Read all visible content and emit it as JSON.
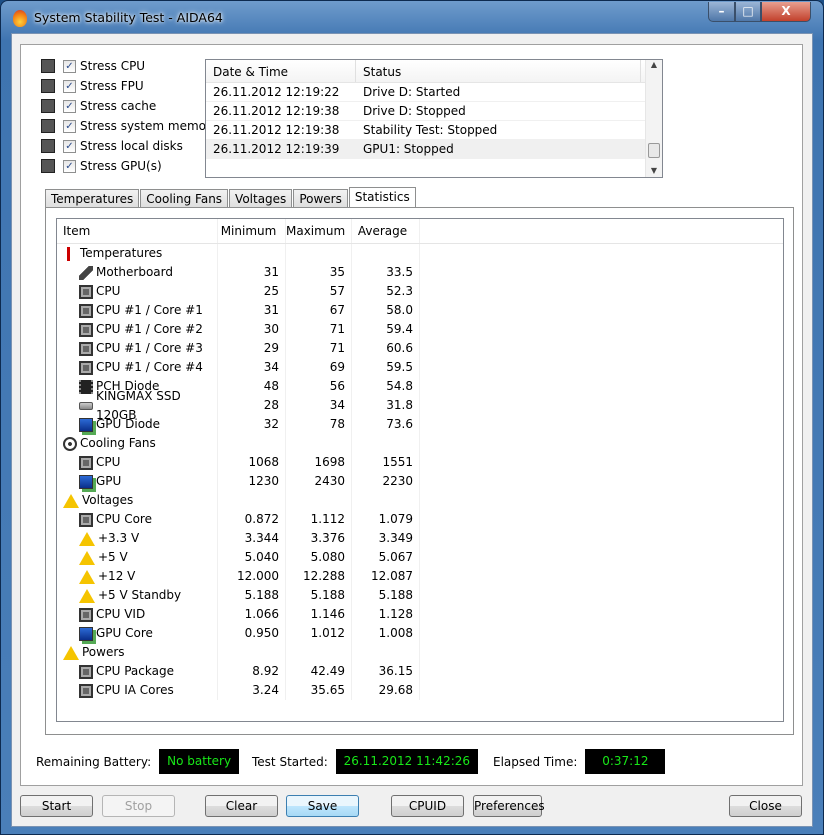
{
  "window": {
    "title": "System Stability Test - AIDA64",
    "minimize": "–",
    "maximize": "□",
    "close": "X"
  },
  "stress": [
    {
      "label": "Stress CPU",
      "checked": true,
      "icon": "cpu-icon"
    },
    {
      "label": "Stress FPU",
      "checked": true,
      "icon": "fpu-icon"
    },
    {
      "label": "Stress cache",
      "checked": true,
      "icon": "cache-icon"
    },
    {
      "label": "Stress system memory",
      "checked": true,
      "icon": "memory-icon"
    },
    {
      "label": "Stress local disks",
      "checked": true,
      "icon": "disk-icon"
    },
    {
      "label": "Stress GPU(s)",
      "checked": true,
      "icon": "gpu-icon"
    }
  ],
  "log": {
    "headers": [
      "Date & Time",
      "Status"
    ],
    "rows": [
      [
        "26.11.2012 12:19:22",
        "Drive D: Started"
      ],
      [
        "26.11.2012 12:19:38",
        "Drive D: Stopped"
      ],
      [
        "26.11.2012 12:19:38",
        "Stability Test: Stopped"
      ],
      [
        "26.11.2012 12:19:39",
        "GPU1: Stopped"
      ]
    ]
  },
  "tabs": [
    "Temperatures",
    "Cooling Fans",
    "Voltages",
    "Powers",
    "Statistics"
  ],
  "active_tab": "Statistics",
  "stats": {
    "headers": [
      "Item",
      "Minimum",
      "Maximum",
      "Average"
    ],
    "rows": [
      {
        "item": "Temperatures",
        "icon": "therm",
        "group": true
      },
      {
        "item": "Motherboard",
        "icon": "mb",
        "min": "31",
        "max": "35",
        "avg": "33.5"
      },
      {
        "item": "CPU",
        "icon": "chip",
        "min": "25",
        "max": "57",
        "avg": "52.3"
      },
      {
        "item": "CPU #1 / Core #1",
        "icon": "chip",
        "min": "31",
        "max": "67",
        "avg": "58.0"
      },
      {
        "item": "CPU #1 / Core #2",
        "icon": "chip",
        "min": "30",
        "max": "71",
        "avg": "59.4"
      },
      {
        "item": "CPU #1 / Core #3",
        "icon": "chip",
        "min": "29",
        "max": "71",
        "avg": "60.6"
      },
      {
        "item": "CPU #1 / Core #4",
        "icon": "chip",
        "min": "34",
        "max": "69",
        "avg": "59.5"
      },
      {
        "item": "PCH Diode",
        "icon": "pch",
        "min": "48",
        "max": "56",
        "avg": "54.8"
      },
      {
        "item": "KINGMAX SSD 120GB",
        "icon": "ssd",
        "min": "28",
        "max": "34",
        "avg": "31.8"
      },
      {
        "item": "GPU Diode",
        "icon": "gpu",
        "min": "32",
        "max": "78",
        "avg": "73.6"
      },
      {
        "item": "Cooling Fans",
        "icon": "fan",
        "group": true
      },
      {
        "item": "CPU",
        "icon": "chip",
        "min": "1068",
        "max": "1698",
        "avg": "1551"
      },
      {
        "item": "GPU",
        "icon": "gpu",
        "min": "1230",
        "max": "2430",
        "avg": "2230"
      },
      {
        "item": "Voltages",
        "icon": "warn",
        "group": true
      },
      {
        "item": "CPU Core",
        "icon": "chip",
        "min": "0.872",
        "max": "1.112",
        "avg": "1.079"
      },
      {
        "item": "+3.3 V",
        "icon": "warn",
        "min": "3.344",
        "max": "3.376",
        "avg": "3.349"
      },
      {
        "item": "+5 V",
        "icon": "warn",
        "min": "5.040",
        "max": "5.080",
        "avg": "5.067"
      },
      {
        "item": "+12 V",
        "icon": "warn",
        "min": "12.000",
        "max": "12.288",
        "avg": "12.087"
      },
      {
        "item": "+5 V Standby",
        "icon": "warn",
        "min": "5.188",
        "max": "5.188",
        "avg": "5.188"
      },
      {
        "item": "CPU VID",
        "icon": "chip",
        "min": "1.066",
        "max": "1.146",
        "avg": "1.128"
      },
      {
        "item": "GPU Core",
        "icon": "gpu",
        "min": "0.950",
        "max": "1.012",
        "avg": "1.008"
      },
      {
        "item": "Powers",
        "icon": "warn",
        "group": true
      },
      {
        "item": "CPU Package",
        "icon": "chip",
        "min": "8.92",
        "max": "42.49",
        "avg": "36.15"
      },
      {
        "item": "CPU IA Cores",
        "icon": "chip",
        "min": "3.24",
        "max": "35.65",
        "avg": "29.68"
      }
    ]
  },
  "status": {
    "battery_label": "Remaining Battery:",
    "battery": "No battery",
    "started_label": "Test Started:",
    "started": "26.11.2012 11:42:26",
    "elapsed_label": "Elapsed Time:",
    "elapsed": "0:37:12",
    "lcd_text_color": "#18e818"
  },
  "buttons": {
    "start": "Start",
    "stop": "Stop",
    "clear": "Clear",
    "save": "Save",
    "cpuid": "CPUID",
    "preferences": "Preferences",
    "close": "Close"
  }
}
